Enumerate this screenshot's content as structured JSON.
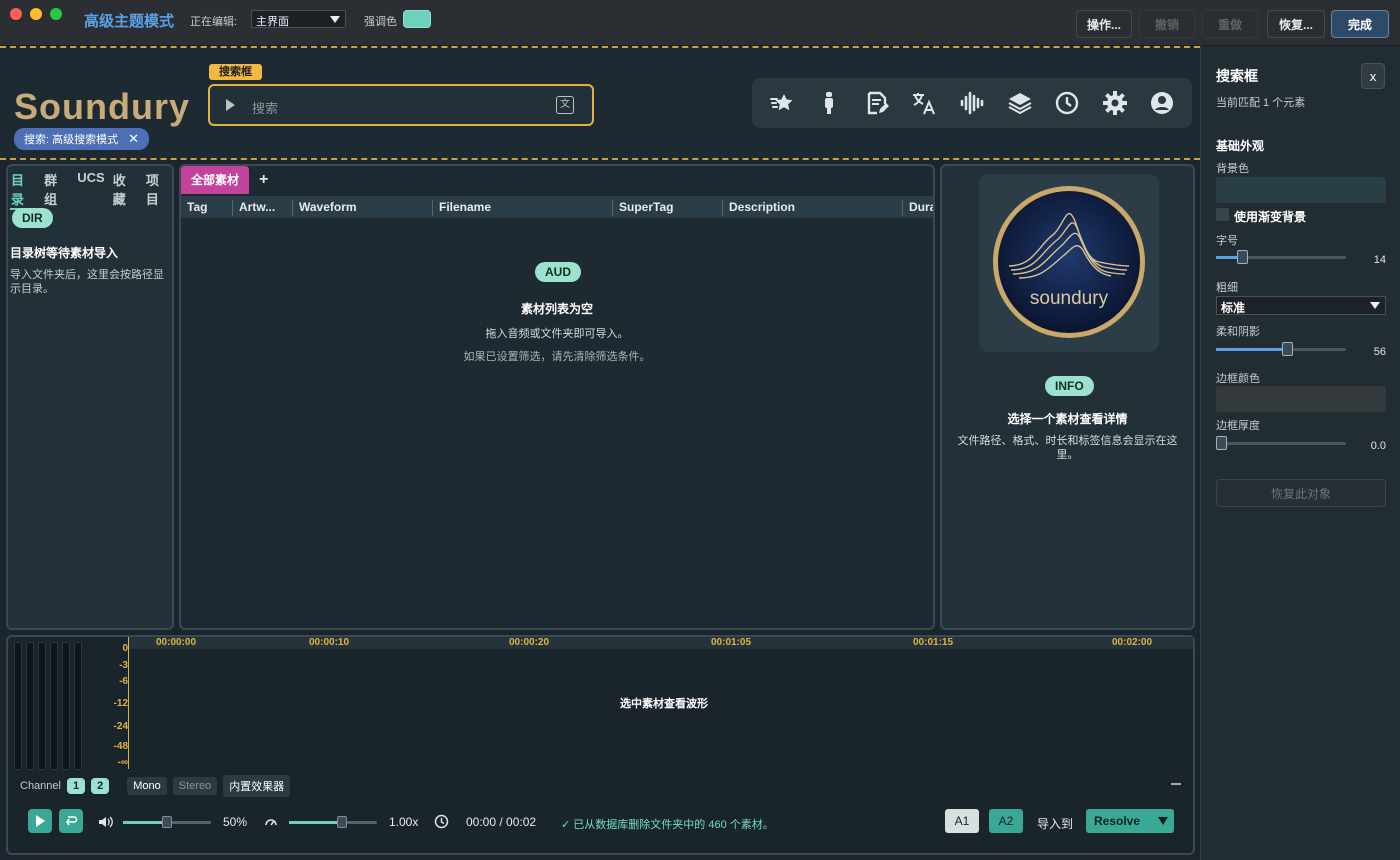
{
  "titlebar": {
    "title": "高级主题模式",
    "editing_label": "正在编辑:",
    "editing_value": "主界面",
    "accent_label": "强调色",
    "accent_color": "#6fd1bd",
    "buttons": {
      "ops": "操作...",
      "undo": "撤销",
      "redo": "重做",
      "restore": "恢复...",
      "done": "完成"
    }
  },
  "header": {
    "logo": "Soundury",
    "search_chip": "搜索: 高级搜索模式",
    "search_tag": "搜索框",
    "search_placeholder": "搜索",
    "toolbar_icons": [
      "favorites-star-icon",
      "microphone-icon",
      "document-edit-icon",
      "translate-icon",
      "waveform-icon",
      "layers-icon",
      "history-clock-icon",
      "settings-gear-icon",
      "user-account-icon"
    ]
  },
  "left_panel": {
    "tabs": [
      "目录",
      "群组",
      "UCS",
      "收藏",
      "项目"
    ],
    "active_tab": "目录",
    "badge": "DIR",
    "title": "目录树等待素材导入",
    "desc": "导入文件夹后，这里会按路径显示目录。"
  },
  "mid_panel": {
    "tab": "全部素材",
    "add": "+",
    "columns": [
      "Tag",
      "Artw...",
      "Waveform",
      "Filename",
      "SuperTag",
      "Description",
      "Dura"
    ],
    "badge": "AUD",
    "empty_title": "素材列表为空",
    "empty_line1": "拖入音频或文件夹即可导入。",
    "empty_line2": "如果已设置筛选，请先清除筛选条件。"
  },
  "right_panel": {
    "artwork_text": "soundury",
    "badge": "INFO",
    "title": "选择一个素材查看详情",
    "desc": "文件路径、格式、时长和标签信息会显示在这里。"
  },
  "waveform": {
    "db_labels": [
      "0",
      "-3",
      "-6",
      "-12",
      "-24",
      "-48",
      "-∞"
    ],
    "time_labels": [
      "00:00:00",
      "00:00:10",
      "00:00:20",
      "00:01:05",
      "00:01:15",
      "00:02:00"
    ],
    "message": "选中素材查看波形",
    "channel_label": "Channel",
    "channels": [
      "1",
      "2"
    ],
    "modes": [
      "Mono",
      "Stereo",
      "内置效果器"
    ]
  },
  "transport": {
    "volume": "50%",
    "volume_level": 0.5,
    "speed": "1.00x",
    "speed_level": 0.6,
    "time": "00:00 / 00:02",
    "status": "✓ 已从数据库删除文件夹中的 460 个素材。",
    "a1": "A1",
    "a2": "A2",
    "import_to": "导入到",
    "target": "Resolve"
  },
  "inspector": {
    "title": "搜索框",
    "close": "x",
    "match": "当前匹配 1 个元素",
    "section": "基础外观",
    "bg_label": "背景色",
    "bg_color": "#2a3e45",
    "gradient_label": "使用渐变背景",
    "font_size_label": "字号",
    "font_size": "14",
    "weight_label": "粗细",
    "weight_value": "标准",
    "shadow_label": "柔和阴影",
    "shadow": "56",
    "border_color_label": "边框颜色",
    "border_color": "#33393d",
    "border_width_label": "边框厚度",
    "border_width": "0.0",
    "reset": "恢复此对象"
  }
}
